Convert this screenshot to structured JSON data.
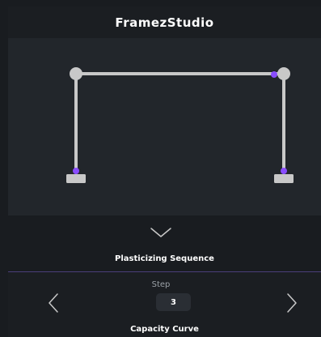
{
  "app": {
    "title": "FramezStudio"
  },
  "frame_view": {
    "element_color": "#c8c8c8",
    "hinge_color": "#8a4dff",
    "joint_icon": "circle-joint",
    "support_icon": "fixed-support"
  },
  "sequence": {
    "toggle_icon": "chevron-down-icon",
    "label": "Plasticizing Sequence"
  },
  "step_nav": {
    "caption": "Step",
    "value": "3",
    "prev_icon": "chevron-left-icon",
    "next_icon": "chevron-right-icon"
  },
  "capacity": {
    "label": "Capacity Curve"
  },
  "colors": {
    "background": "#191c20",
    "canvas": "#22262b",
    "accent": "#8a4dff"
  }
}
